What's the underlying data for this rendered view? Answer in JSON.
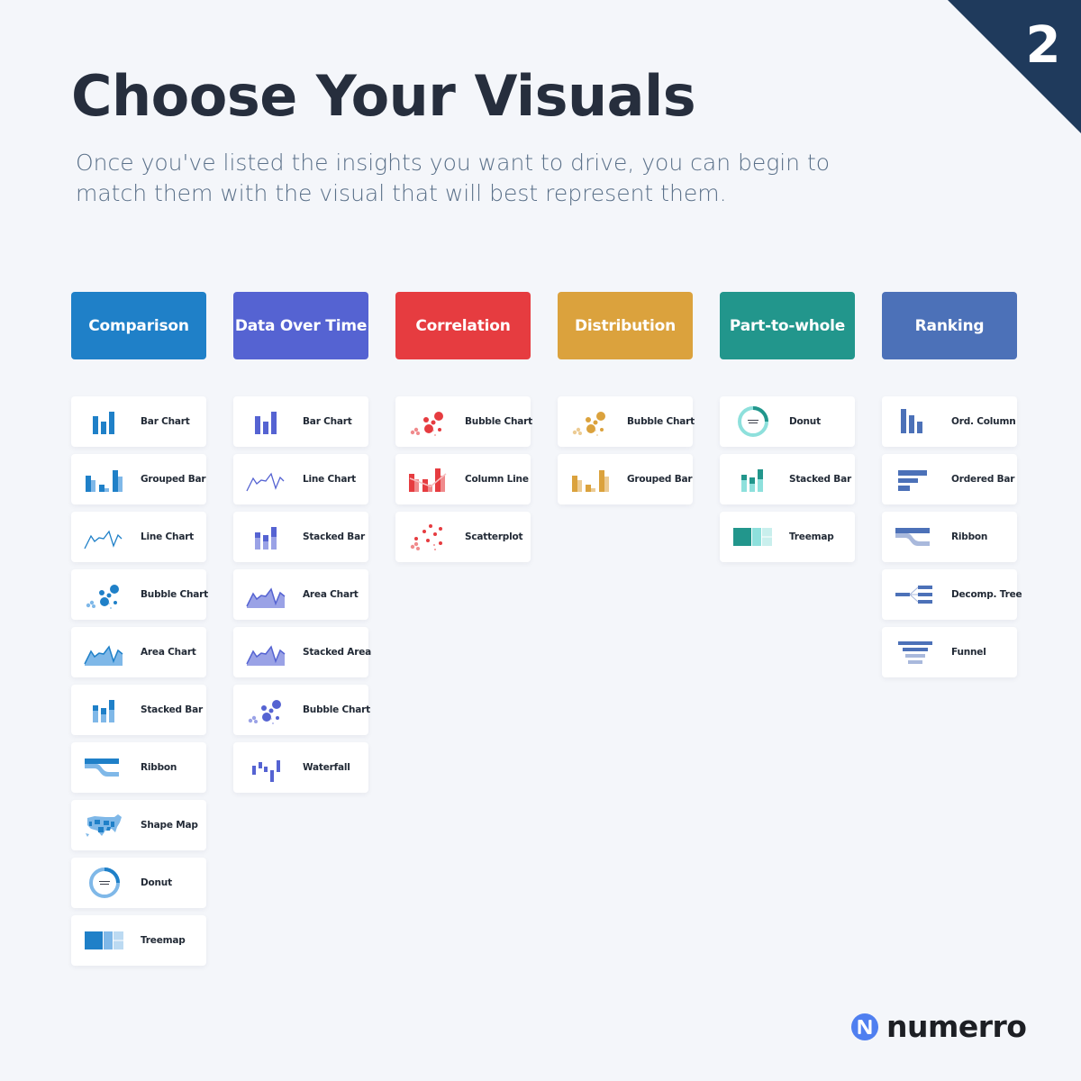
{
  "page_number": "2",
  "title": "Choose Your Visuals",
  "subtitle": "Once you've listed the insights you want to drive, you can begin to match them with the visual that will best represent them.",
  "brand": {
    "name": "numerro",
    "logo_color": "#4f7ff0"
  },
  "colors": {
    "corner": "#1f3a5c",
    "background": "#f4f6fa"
  },
  "categories": [
    {
      "label": "Comparison",
      "color": "#1f80c8",
      "light": "#7fb8e8",
      "pale": "#bcdaf2",
      "items": [
        {
          "label": "Bar Chart",
          "icon": "bar-chart"
        },
        {
          "label": "Grouped Bar",
          "icon": "grouped-bar"
        },
        {
          "label": "Line Chart",
          "icon": "line-chart"
        },
        {
          "label": "Bubble Chart",
          "icon": "bubble-chart"
        },
        {
          "label": "Area Chart",
          "icon": "area-chart"
        },
        {
          "label": "Stacked Bar",
          "icon": "stacked-bar"
        },
        {
          "label": "Ribbon",
          "icon": "ribbon"
        },
        {
          "label": "Shape Map",
          "icon": "shape-map"
        },
        {
          "label": "Donut",
          "icon": "donut"
        },
        {
          "label": "Treemap",
          "icon": "treemap"
        }
      ]
    },
    {
      "label": "Data Over Time",
      "color": "#5563d2",
      "light": "#9aa2e6",
      "pale": "#c5caf0",
      "items": [
        {
          "label": "Bar Chart",
          "icon": "bar-chart"
        },
        {
          "label": "Line Chart",
          "icon": "line-chart"
        },
        {
          "label": "Stacked Bar",
          "icon": "stacked-bar"
        },
        {
          "label": "Area Chart",
          "icon": "area-chart"
        },
        {
          "label": "Stacked Area",
          "icon": "stacked-area"
        },
        {
          "label": "Bubble Chart",
          "icon": "bubble-chart"
        },
        {
          "label": "Waterfall",
          "icon": "waterfall"
        }
      ]
    },
    {
      "label": "Correlation",
      "color": "#e63c40",
      "light": "#f08a8c",
      "pale": "#f7c0c1",
      "items": [
        {
          "label": "Bubble Chart",
          "icon": "bubble-chart"
        },
        {
          "label": "Column Line",
          "icon": "column-line"
        },
        {
          "label": "Scatterplot",
          "icon": "scatterplot"
        }
      ]
    },
    {
      "label": "Distribution",
      "color": "#dba23d",
      "light": "#eccb93",
      "pale": "#f3e0bd",
      "items": [
        {
          "label": "Bubble Chart",
          "icon": "bubble-chart"
        },
        {
          "label": "Grouped Bar",
          "icon": "grouped-bar"
        }
      ]
    },
    {
      "label": "Part-to-whole",
      "color": "#22968c",
      "light": "#8ee0dc",
      "pale": "#c9efed",
      "items": [
        {
          "label": "Donut",
          "icon": "donut"
        },
        {
          "label": "Stacked Bar",
          "icon": "stacked-bar"
        },
        {
          "label": "Treemap",
          "icon": "treemap"
        }
      ]
    },
    {
      "label": "Ranking",
      "color": "#4c71b8",
      "light": "#a9b9dc",
      "pale": "#cfd9ee",
      "items": [
        {
          "label": "Ord. Column",
          "icon": "ordered-column"
        },
        {
          "label": "Ordered Bar",
          "icon": "ordered-bar"
        },
        {
          "label": "Ribbon",
          "icon": "ribbon"
        },
        {
          "label": "Decomp. Tree",
          "icon": "decomposition-tree"
        },
        {
          "label": "Funnel",
          "icon": "funnel"
        }
      ]
    }
  ]
}
